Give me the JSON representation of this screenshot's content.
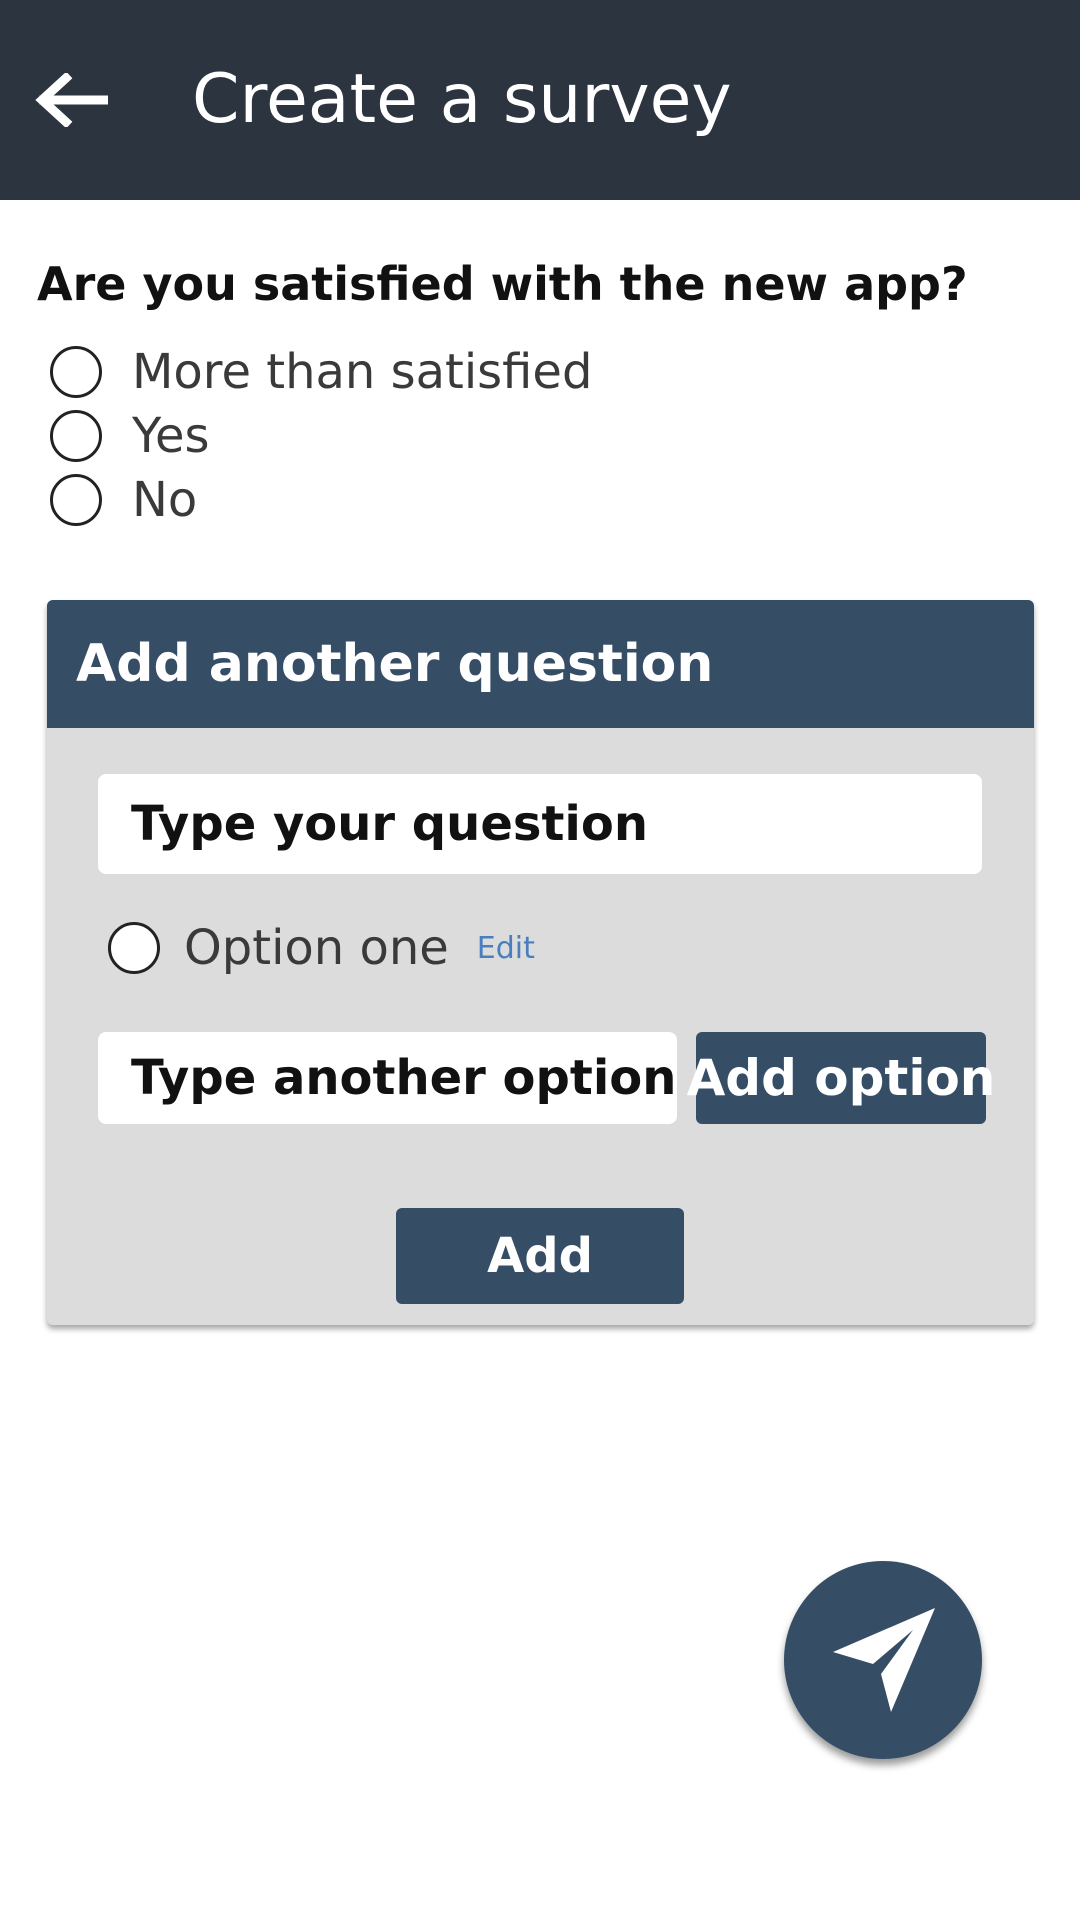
{
  "header": {
    "title": "Create a survey",
    "back_icon": "arrow-left-icon",
    "background": "#2c3440"
  },
  "survey": {
    "question": "Are you satisfied with the new app?",
    "options": [
      {
        "label": "More than satisfied"
      },
      {
        "label": "Yes"
      },
      {
        "label": "No"
      }
    ]
  },
  "add_question_card": {
    "title": "Add another question",
    "question_placeholder": "Type your question",
    "draft_option": {
      "label": "Option one",
      "edit_label": "Edit"
    },
    "option_placeholder": "Type another option",
    "add_option_label": "Add option",
    "add_label": "Add",
    "accent": "#364d66"
  },
  "fab": {
    "icon": "send-paper-plane-icon",
    "color": "#364d66"
  }
}
